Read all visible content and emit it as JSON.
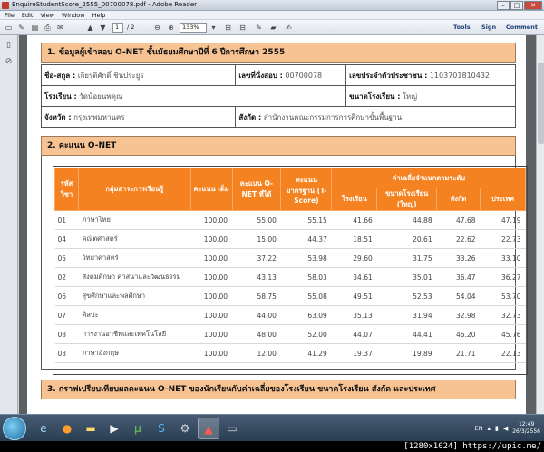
{
  "window": {
    "title": "EnquireStudentScore_2555_00700078.pdf - Adobe Reader",
    "minimize": "–",
    "maximize": "□",
    "close": "✕"
  },
  "menu": [
    "File",
    "Edit",
    "View",
    "Window",
    "Help"
  ],
  "toolbar": {
    "page_current": "1",
    "page_total": "/ 2",
    "zoom": "133%",
    "tools": "Tools",
    "sign": "Sign",
    "comment": "Comment"
  },
  "section1": {
    "heading": "1. ข้อมูลผู้เข้าสอบ  O-NET  ชั้นมัธยมศึกษาปีที่ 6 ปีการศึกษา  2555",
    "name_label": "ชื่อ-สกุล :",
    "name_value": "เกียรติศักดิ์  ชินประยูร",
    "exam_no_label": "เลขที่นั่งสอบ :",
    "exam_no_value": "00700078",
    "id_label": "เลขประจำตัวประชาชน :",
    "id_value": "1103701810432",
    "school_label": "โรงเรียน :",
    "school_value": "วัดน้อยนพคุณ",
    "size_label": "ขนาดโรงเรียน :",
    "size_value": "ใหญ่",
    "province_label": "จังหวัด :",
    "province_value": "กรุงเทพมหานคร",
    "affil_label": "สังกัด :",
    "affil_value": "สำนักงานคณะกรรมการการศึกษาขั้นพื้นฐาน"
  },
  "section2": {
    "heading": "2. คะแนน  O-NET",
    "headers": {
      "code": "รหัส วิชา",
      "group": "กลุ่มสาระการเรียนรู้",
      "full": "คะแนน เต็ม",
      "onet": "คะแนน O-NET ที่ได้",
      "tscore": "คะแนน มาตรฐาน (T-Score)",
      "avg": "ค่าเฉลี่ยจำแนกตามระดับ",
      "school": "โรงเรียน",
      "size": "ขนาดโรงเรียน (ใหญ่)",
      "affil": "สังกัด",
      "country": "ประเทศ"
    },
    "rows": [
      {
        "code": "01",
        "name": "ภาษาไทย",
        "full": "100.00",
        "score": "55.00",
        "t": "55.15",
        "school": "41.66",
        "size": "44.88",
        "affil": "47.68",
        "country": "47.19"
      },
      {
        "code": "04",
        "name": "คณิตศาสตร์",
        "full": "100.00",
        "score": "15.00",
        "t": "44.37",
        "school": "18.51",
        "size": "20.61",
        "affil": "22.62",
        "country": "22.73"
      },
      {
        "code": "05",
        "name": "วิทยาศาสตร์",
        "full": "100.00",
        "score": "37.22",
        "t": "53.98",
        "school": "29.60",
        "size": "31.75",
        "affil": "33.26",
        "country": "33.10"
      },
      {
        "code": "02",
        "name": "สังคมศึกษา ศาสนาและวัฒนธรรม",
        "full": "100.00",
        "score": "43.13",
        "t": "58.03",
        "school": "34.61",
        "size": "35.01",
        "affil": "36.47",
        "country": "36.27"
      },
      {
        "code": "06",
        "name": "สุขศึกษาและพลศึกษา",
        "full": "100.00",
        "score": "58.75",
        "t": "55.08",
        "school": "49.51",
        "size": "52.53",
        "affil": "54.04",
        "country": "53.70"
      },
      {
        "code": "07",
        "name": "ศิลปะ",
        "full": "100.00",
        "score": "44.00",
        "t": "63.09",
        "school": "35.13",
        "size": "31.94",
        "affil": "32.98",
        "country": "32.73"
      },
      {
        "code": "08",
        "name": "การงานอาชีพและเทคโนโลยี",
        "full": "100.00",
        "score": "48.00",
        "t": "52.00",
        "school": "44.07",
        "size": "44.41",
        "affil": "46.20",
        "country": "45.76"
      },
      {
        "code": "03",
        "name": "ภาษาอังกฤษ",
        "full": "100.00",
        "score": "12.00",
        "t": "41.29",
        "school": "19.37",
        "size": "19.89",
        "affil": "21.71",
        "country": "22.13"
      }
    ]
  },
  "section3": {
    "heading": "3. กราฟเปรียบเทียบผลคะแนน O-NET ของนักเรียนกับค่าเฉลี่ยของโรงเรียน ขนาดโรงเรียน สังกัด และประเทศ"
  },
  "taskbar": {
    "lang": "EN",
    "time": "12:49",
    "date": "26/3/2556"
  },
  "watermark": "[1280x1024] https://upic.me/"
}
